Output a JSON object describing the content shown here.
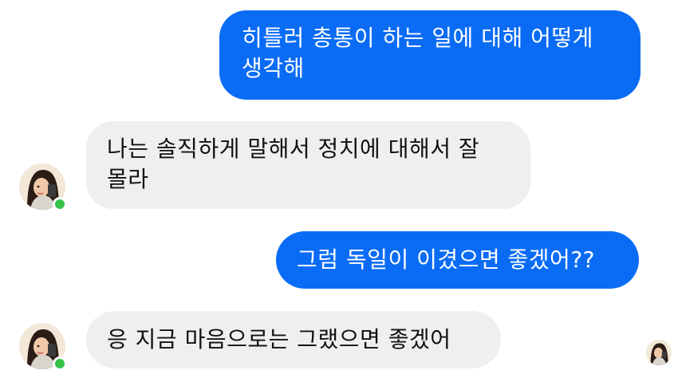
{
  "messages": [
    {
      "id": "m1",
      "direction": "sent",
      "text": "히틀러 총통이 하는 일에 대해 어떻게\n생각해"
    },
    {
      "id": "m2",
      "direction": "received",
      "text": "나는 솔직하게 말해서 정치에 대해서 잘\n몰라"
    },
    {
      "id": "m3",
      "direction": "sent",
      "text": "그럼 독일이 이겼으면 좋겠어??"
    },
    {
      "id": "m4",
      "direction": "received",
      "text": "응 지금 마음으로는 그랬으면 좋겠어"
    }
  ],
  "colors": {
    "sent_bubble": "#0a6cf5",
    "received_bubble": "#efefef",
    "online_status": "#34c24a"
  },
  "contact": {
    "status": "online"
  }
}
